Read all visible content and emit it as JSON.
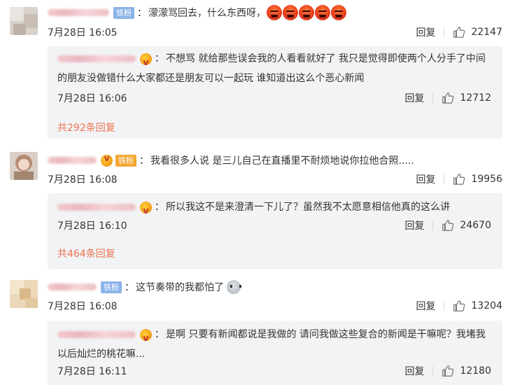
{
  "comments": [
    {
      "badge": "铁粉",
      "text": "濛濛骂回去，什么东西呀，",
      "emoji_name": "angry-face-icon",
      "time": "7月28日 16:05",
      "reply_label": "回复",
      "likes": "22147",
      "reply": {
        "text": "不想骂 就给那些误会我的人看看就好了 我只是觉得即使两个人分手了中间的朋友没做错什么大家都还是朋友可以一起玩 谁知道出这么个恶心新闻",
        "time": "7月28日 16:06",
        "reply_label": "回复",
        "likes": "12712"
      },
      "more_label": "共292条回复"
    },
    {
      "badge": "铁粉",
      "text": "我看很多人说 是三儿自己在直播里不耐烦地说你拉他合照.....",
      "time": "7月28日 16:08",
      "reply_label": "回复",
      "likes": "19956",
      "reply": {
        "text": "所以我这不是来澄清一下儿了？虽然我不太愿意相信他真的这么讲",
        "time": "7月28日 16:10",
        "reply_label": "回复",
        "likes": "24670"
      },
      "more_label": "共464条回复"
    },
    {
      "badge": "铁粉",
      "text": "这节奏带的我都怕了",
      "emoji_name": "robot-face-icon",
      "time": "7月28日 16:08",
      "reply_label": "回复",
      "likes": "13204",
      "reply": {
        "text": "是啊 只要有新闻都说是我做的 请问我做这些复合的新闻是干嘛呢？我堵我以后灿烂的桃花嘛...",
        "time": "7月28日 16:11",
        "reply_label": "回复",
        "likes": "12180"
      }
    }
  ],
  "colors": {
    "link_orange": "#eb7350",
    "badge_blue": "#8cb3e8",
    "badge_gold": "#f3a732",
    "reply_bg": "#f2f3f5"
  }
}
